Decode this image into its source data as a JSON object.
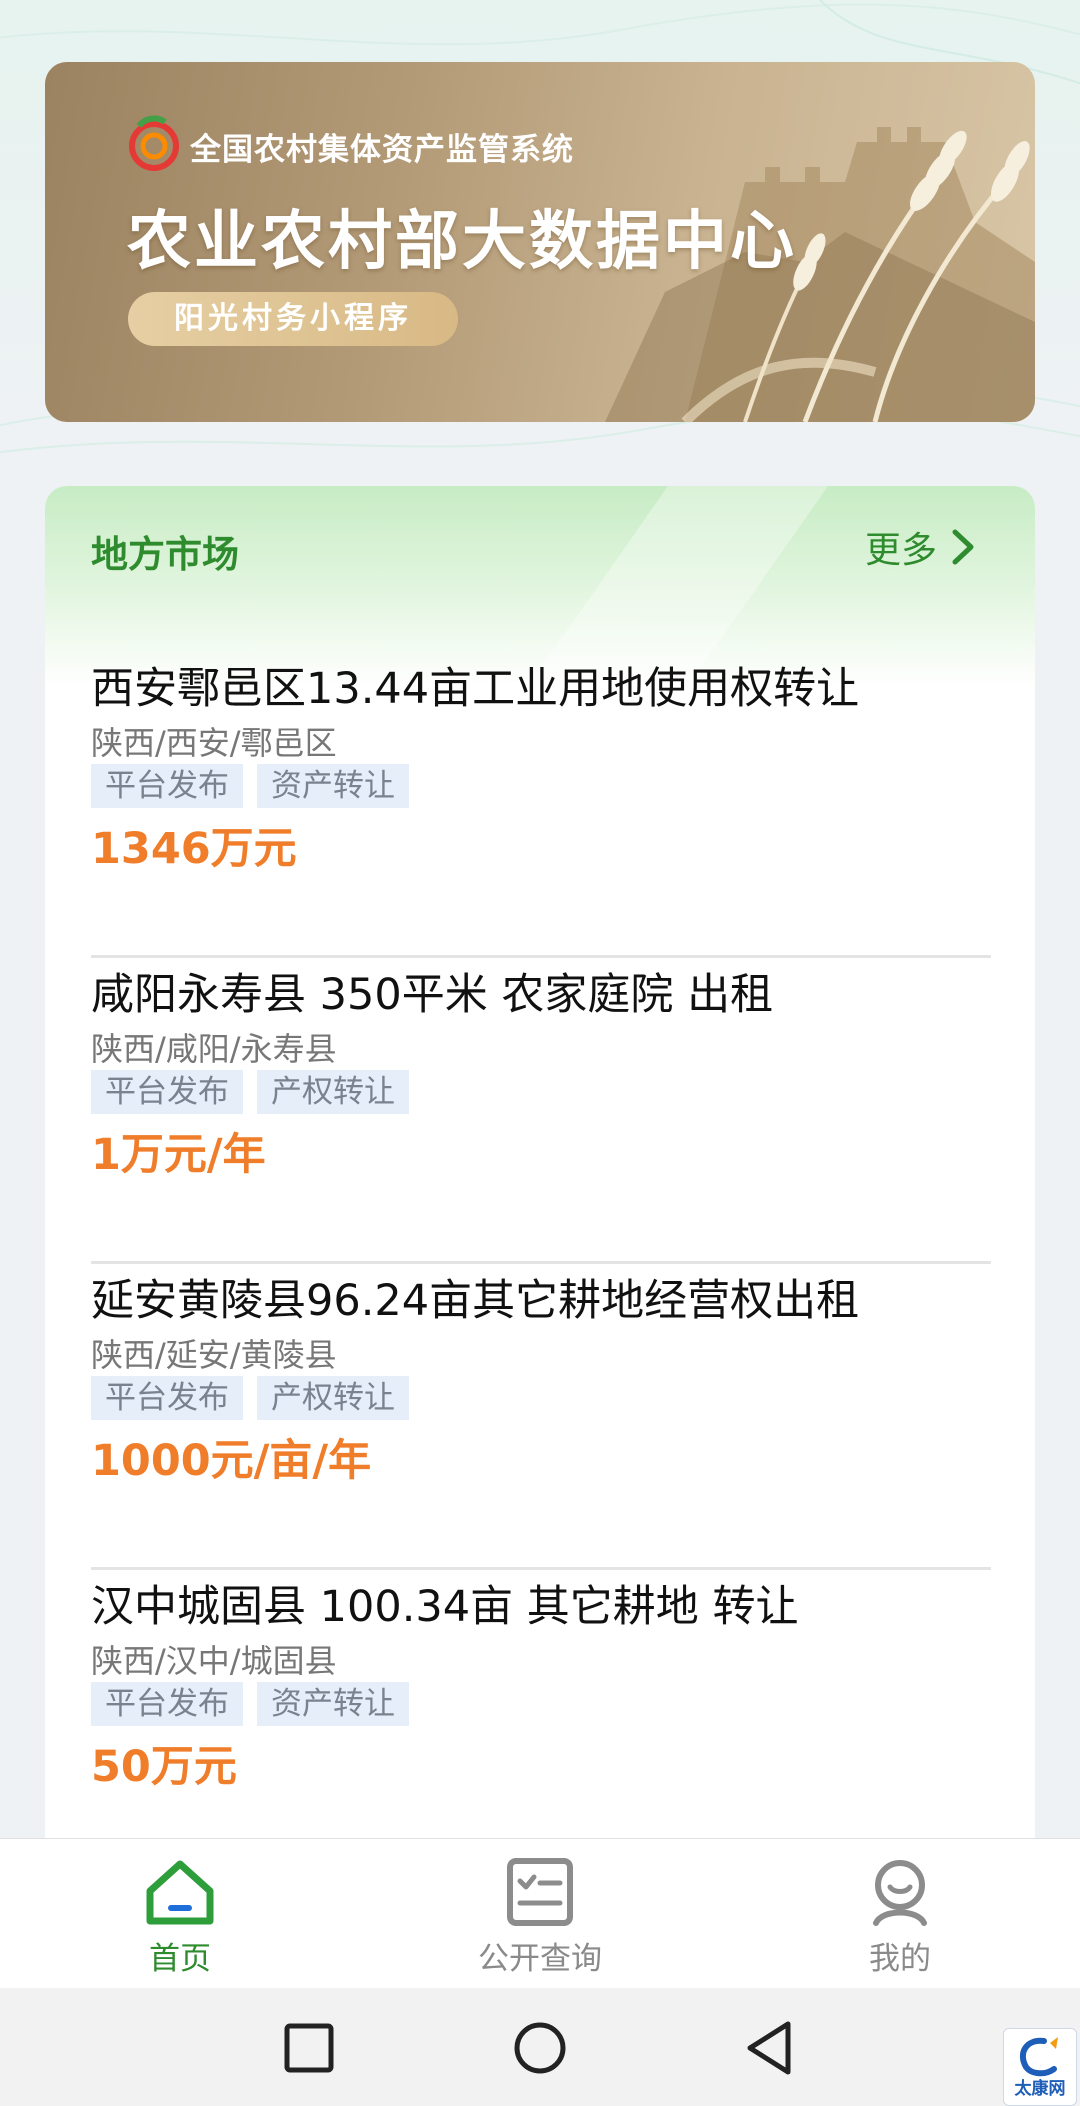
{
  "banner": {
    "subtitle": "全国农村集体资产监管系统",
    "title": "农业农村部大数据中心",
    "pill": "阳光村务小程序"
  },
  "market": {
    "title": "地方市场",
    "more_label": "更多",
    "listings": [
      {
        "title": "西安鄠邑区13.44亩工业用地使用权转让",
        "location": "陕西/西安/鄠邑区",
        "tags": [
          "平台发布",
          "资产转让"
        ],
        "price": "1346万元"
      },
      {
        "title": "咸阳永寿县 350平米 农家庭院 出租",
        "location": "陕西/咸阳/永寿县",
        "tags": [
          "平台发布",
          "产权转让"
        ],
        "price": "1万元/年"
      },
      {
        "title": "延安黄陵县96.24亩其它耕地经营权出租",
        "location": "陕西/延安/黄陵县",
        "tags": [
          "平台发布",
          "产权转让"
        ],
        "price": "1000元/亩/年"
      },
      {
        "title": "汉中城固县 100.34亩 其它耕地 转让",
        "location": "陕西/汉中/城固县",
        "tags": [
          "平台发布",
          "资产转让"
        ],
        "price": "50万元"
      }
    ]
  },
  "tabbar": {
    "tabs": [
      {
        "label": "首页",
        "icon": "home-icon",
        "active": true
      },
      {
        "label": "公开查询",
        "icon": "checklist-icon",
        "active": false
      },
      {
        "label": "我的",
        "icon": "profile-icon",
        "active": false
      }
    ]
  },
  "system_nav": {
    "buttons": [
      "recents-square-icon",
      "home-circle-icon",
      "back-triangle-icon"
    ]
  },
  "watermark": {
    "text": "太康网"
  },
  "colors": {
    "accent_green": "#2e8b2e",
    "price_orange": "#ef7d2a",
    "tag_bg": "#e6eef9"
  }
}
